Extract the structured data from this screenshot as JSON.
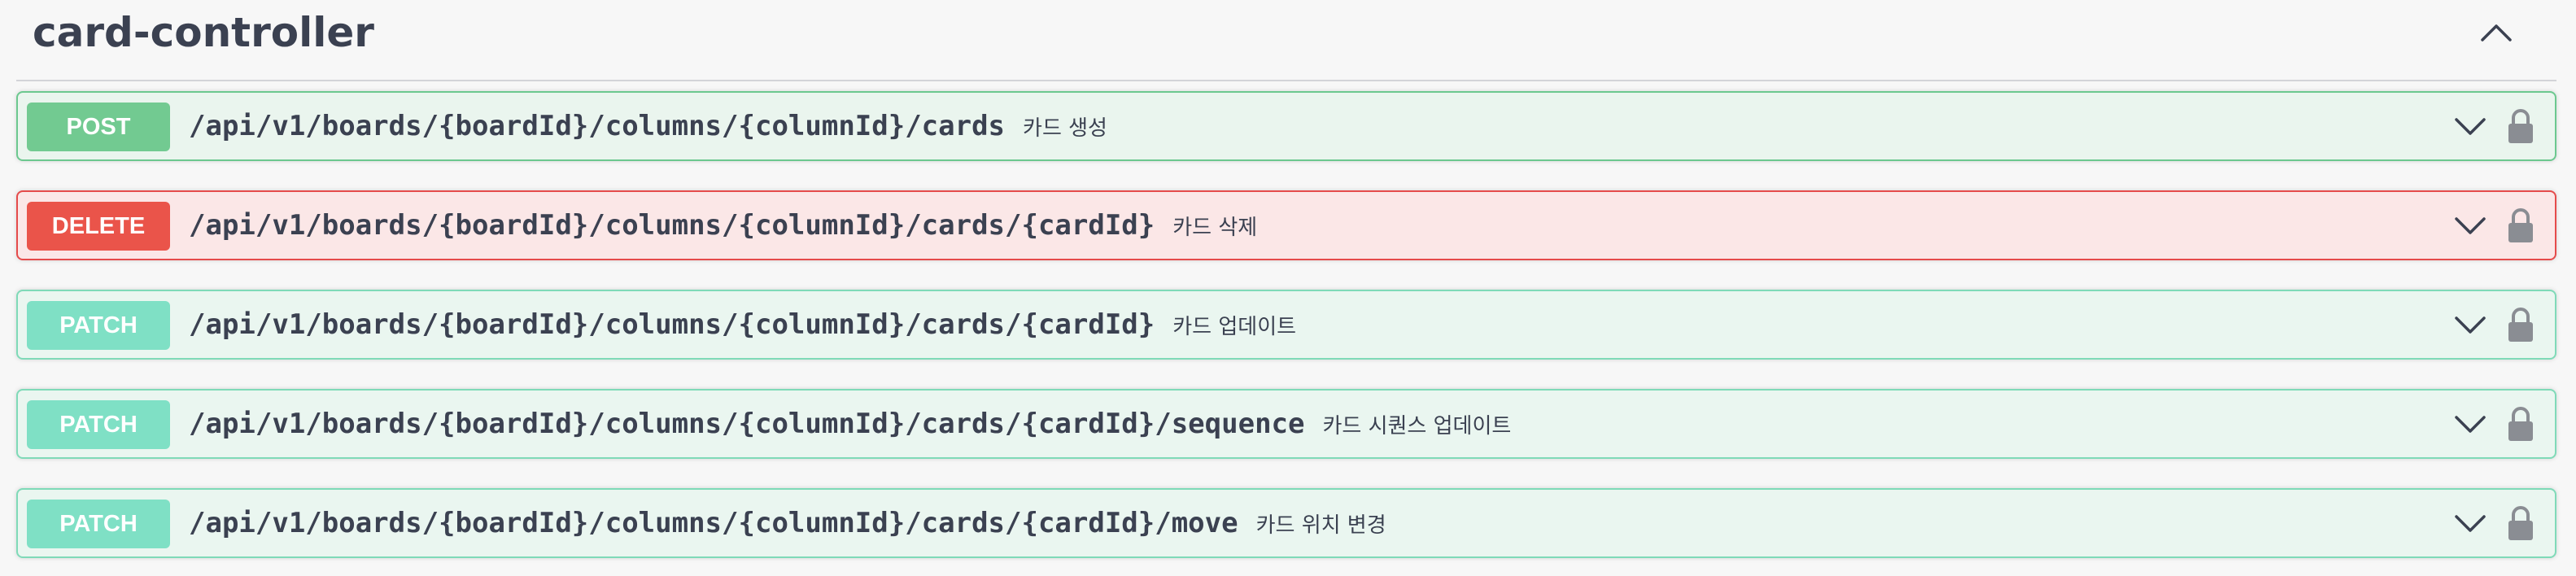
{
  "section": {
    "title": "card-controller",
    "toggle_icon": "chevron-up-icon"
  },
  "operations": [
    {
      "method": "POST",
      "path": "/api/v1/boards/{boardId}/columns/{columnId}/cards",
      "summary": "카드 생성",
      "expand_icon": "chevron-down-icon",
      "auth_icon": "lock-icon"
    },
    {
      "method": "DELETE",
      "path": "/api/v1/boards/{boardId}/columns/{columnId}/cards/{cardId}",
      "summary": "카드 삭제",
      "expand_icon": "chevron-down-icon",
      "auth_icon": "lock-icon"
    },
    {
      "method": "PATCH",
      "path": "/api/v1/boards/{boardId}/columns/{columnId}/cards/{cardId}",
      "summary": "카드 업데이트",
      "expand_icon": "chevron-down-icon",
      "auth_icon": "lock-icon"
    },
    {
      "method": "PATCH",
      "path": "/api/v1/boards/{boardId}/columns/{columnId}/cards/{cardId}/sequence",
      "summary": "카드 시퀀스 업데이트",
      "expand_icon": "chevron-down-icon",
      "auth_icon": "lock-icon"
    },
    {
      "method": "PATCH",
      "path": "/api/v1/boards/{boardId}/columns/{columnId}/cards/{cardId}/move",
      "summary": "카드 위치 변경",
      "expand_icon": "chevron-down-icon",
      "auth_icon": "lock-icon"
    }
  ],
  "colors": {
    "post": "#72ca91",
    "delete": "#ea544a",
    "patch": "#7fe0c5",
    "text": "#3b4151",
    "icon": "#8a8d93"
  }
}
